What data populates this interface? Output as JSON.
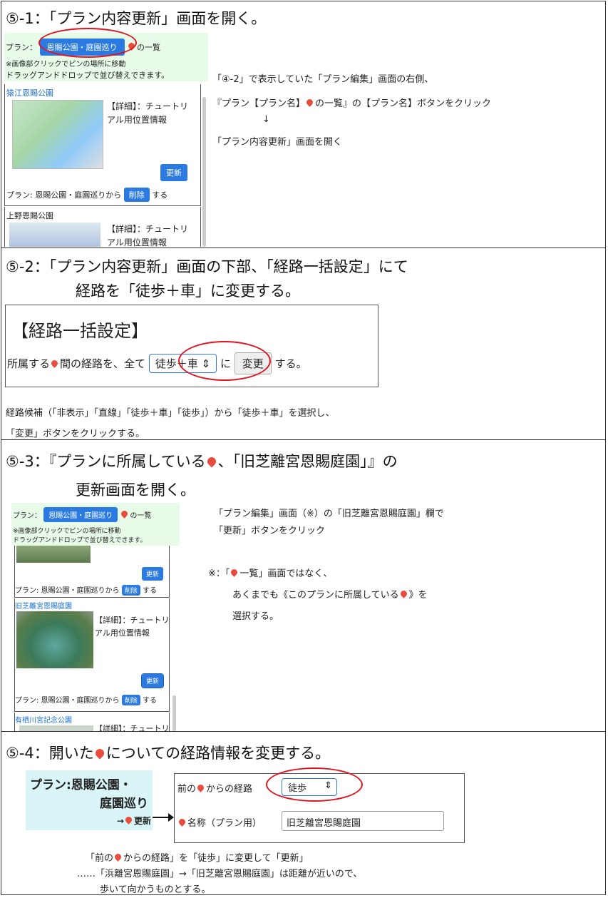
{
  "s1": {
    "heading": "⑤-1：「プラン内容更新」画面を開く。",
    "plan_label": "プラン：",
    "plan_button": "恩賜公園・庭園巡り",
    "plan_list": "の一覧",
    "hint1": "※画像部クリックでピンの場所に移動",
    "hint2": "ドラッグアンドドロップで並び替えできます。",
    "item1_title": "猿江恩賜公園",
    "item_detail": "【詳細】：チュートリ",
    "item_detail2": "アル用位置情報",
    "update_btn": "更新",
    "remove_prefix": "プラン: 恩賜公園・庭園巡りから",
    "remove_btn": "削除",
    "remove_suffix": "する",
    "item2_title": "上野恩賜公園",
    "note1": "「④-2」で表示していた「プラン編集」画面の右側、",
    "note2a": "『プラン【プラン名】",
    "note2b": "の一覧』の【プラン名】ボタンをクリック",
    "arrow": "↓",
    "note3": "「プラン内容更新」画面を開く"
  },
  "s2": {
    "heading1": "⑤-2：「プラン内容更新」画面の下部、「経路一括設定」にて",
    "heading2": "経路を「徒歩＋車」に変更する。",
    "box_title": "【経路一括設定】",
    "box_prefix": "所属する",
    "box_mid": "間の経路を、全て",
    "select": "徒歩＋車",
    "ni": "に",
    "change_btn": "変更",
    "suru": "する。",
    "note1": "経路候補（「非表示」「直線」「徒歩＋車」「徒歩」）から「徒歩＋車」を選択し、",
    "note2": "「変更」ボタンをクリックする。"
  },
  "s3": {
    "heading1a": "⑤-3：『プランに所属している",
    "heading1b": "、「旧芝離宮恩賜庭園」』の",
    "heading2": "更新画面を開く。",
    "plan_label": "プラン：",
    "plan_button": "恩賜公園・庭園巡り",
    "plan_list": "の一覧",
    "hint1": "※画像部クリックでピンの場所に移動",
    "hint2": "ドラッグアンドドロップで並び替えできます。",
    "update_btn": "更新",
    "remove_prefix": "プラン: 恩賜公園・庭園巡りから",
    "remove_btn": "削除",
    "remove_suffix": "する",
    "item_title": "旧芝離宮恩賜庭園",
    "item_detail": "【詳細】：チュートリ",
    "item_detail2": "アル用位置情報",
    "item3_title": "有栖川宮記念公園",
    "note1": "「プラン編集」画面（※）の「旧芝離宮恩賜庭園」欄で",
    "note2": "「更新」ボタンをクリック",
    "note3a": "※：「",
    "note3b": "一覧」画面ではなく、",
    "note4a": "あくまでも《このプランに所属している",
    "note4b": "》を",
    "note5": "選択する。"
  },
  "s4": {
    "heading_a": "⑤-4：開いた",
    "heading_b": "についての経路情報を変更する。",
    "plan_title1": "プラン:恩賜公園・",
    "plan_title2": "庭園巡り",
    "update_link": "更新",
    "route_label_a": "前の",
    "route_label_b": "からの経路",
    "route_select": "徒歩",
    "name_label": "名称（プラン用）",
    "name_value": "旧芝離宮恩賜庭園",
    "note1a": "「前の",
    "note1b": "からの経路」を「徒歩」に変更して「更新」",
    "note2": "……「浜離宮恩賜庭園」→「旧芝離宮恩賜庭園」は距離が近いので、",
    "note3": "歩いて向かうものとする。"
  }
}
